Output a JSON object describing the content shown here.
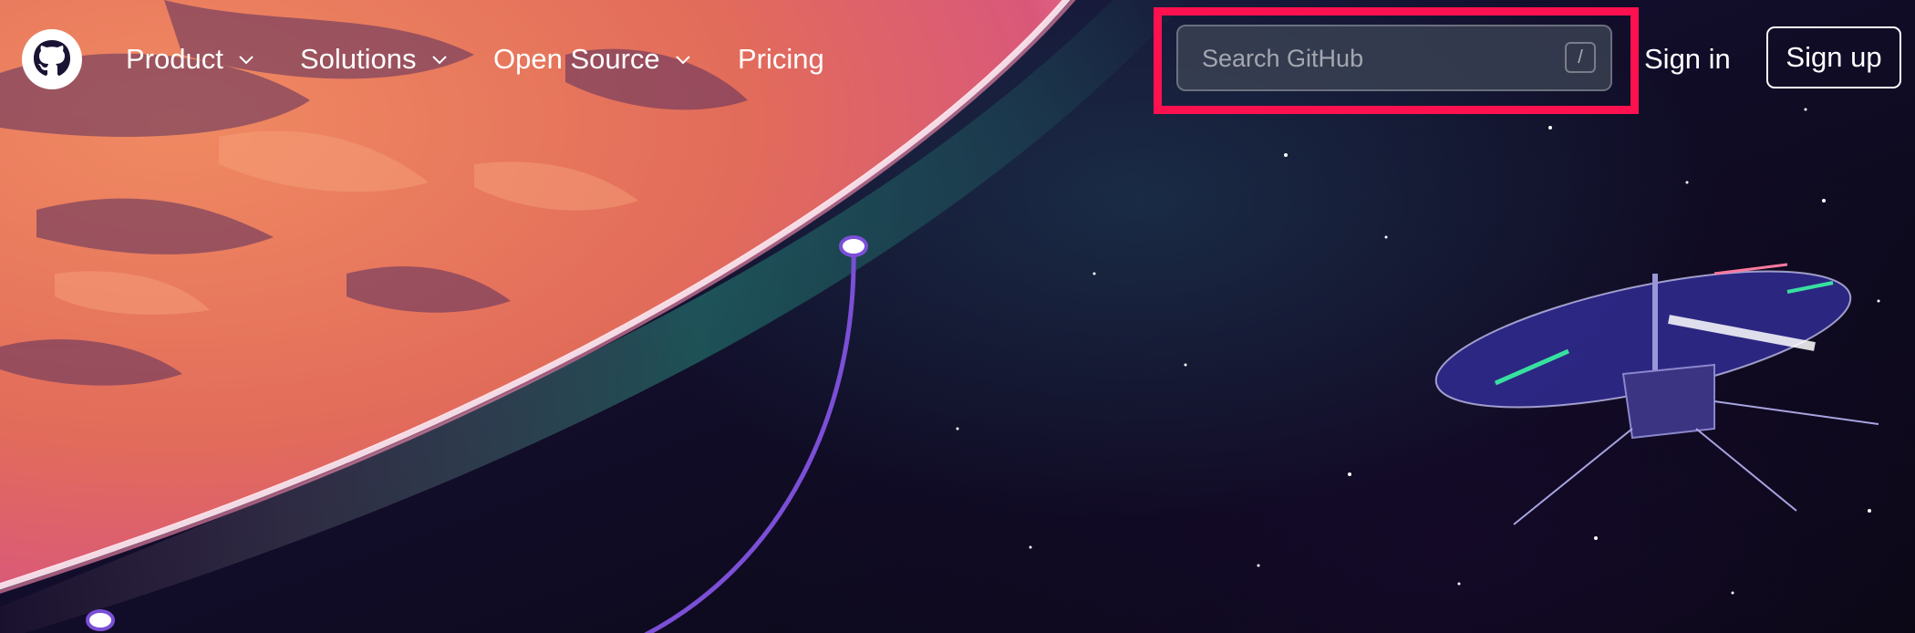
{
  "nav": {
    "logo_icon": "github-mark-icon",
    "items": [
      {
        "label": "Product",
        "has_dropdown": true
      },
      {
        "label": "Solutions",
        "has_dropdown": true
      },
      {
        "label": "Open Source",
        "has_dropdown": true
      },
      {
        "label": "Pricing",
        "has_dropdown": false
      }
    ]
  },
  "search": {
    "placeholder": "Search GitHub",
    "value": "",
    "shortcut_key": "/",
    "highlight_color": "#ff1150"
  },
  "auth": {
    "sign_in_label": "Sign in",
    "sign_up_label": "Sign up"
  },
  "hero": {
    "planet_color": "#e8745a",
    "rim_color": "#ff8fb0",
    "orbit_color": "#7b4fd6",
    "illustration": "mars-planet-with-helicopter"
  }
}
